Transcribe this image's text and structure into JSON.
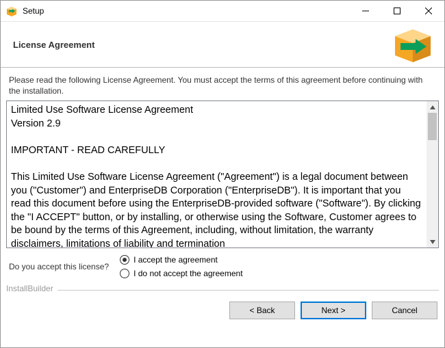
{
  "window": {
    "title": "Setup"
  },
  "header": {
    "heading": "License Agreement"
  },
  "content": {
    "instruction": "Please read the following License Agreement. You must accept the terms of this agreement before continuing with the installation.",
    "license_text": "Limited Use Software License Agreement\nVersion 2.9\n\nIMPORTANT - READ CAREFULLY\n\nThis Limited Use Software License Agreement (\"Agreement\") is a legal document between you (\"Customer\") and EnterpriseDB Corporation (\"EnterpriseDB\"). It is important that you read this document before using the EnterpriseDB-provided software (\"Software\"). By clicking the \"I ACCEPT\" button, or by installing, or otherwise using the Software, Customer agrees to be bound by the terms of this Agreement, including, without limitation, the warranty disclaimers, limitations of liability and termination"
  },
  "accept": {
    "question": "Do you accept this license?",
    "options": {
      "yes": "I accept the agreement",
      "no": "I do not accept the agreement"
    },
    "selected": "yes"
  },
  "branding": "InstallBuilder",
  "footer": {
    "back": "< Back",
    "next": "Next >",
    "cancel": "Cancel"
  },
  "icons": {
    "app": "box-arrow",
    "minimize": "minimize",
    "maximize": "maximize",
    "close": "close",
    "logo": "box-arrow-large",
    "scroll_up": "chevron-up",
    "scroll_down": "chevron-down"
  }
}
